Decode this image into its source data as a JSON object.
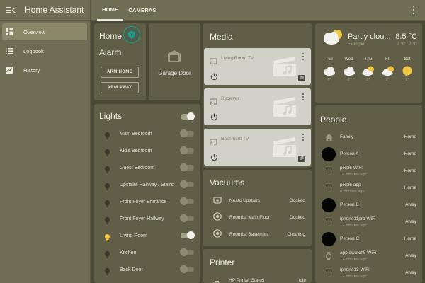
{
  "app": {
    "title": "Home Assistant"
  },
  "sidebar": {
    "items": [
      {
        "label": "Overview",
        "icon": "overview-grid-icon",
        "active": true
      },
      {
        "label": "Logbook",
        "icon": "logbook-list-icon",
        "active": false
      },
      {
        "label": "History",
        "icon": "history-chart-icon",
        "active": false
      }
    ]
  },
  "topbar": {
    "tabs": [
      {
        "label": "HOME",
        "active": true
      },
      {
        "label": "CAMERAS",
        "active": false
      }
    ]
  },
  "alarm": {
    "title_line1": "Home",
    "title_line2": "Alarm",
    "arm_home_label": "ARM HOME",
    "arm_away_label": "ARM AWAY",
    "badge_color": "#1e9e8a"
  },
  "garage": {
    "label": "Garage Door"
  },
  "lights": {
    "title": "Lights",
    "master_on": true,
    "items": [
      {
        "name": "Main Bedroom",
        "on": false
      },
      {
        "name": "Kid's Bedroom",
        "on": false
      },
      {
        "name": "Guest Bedroom",
        "on": false
      },
      {
        "name": "Upstairs Hallway / Stairs",
        "on": false
      },
      {
        "name": "Front Foyer Entrance",
        "on": false
      },
      {
        "name": "Front Foyer Hallway",
        "on": false
      },
      {
        "name": "Living Room",
        "on": true
      },
      {
        "name": "Kitchen",
        "on": false
      },
      {
        "name": "Back Door",
        "on": false
      }
    ]
  },
  "media": {
    "title": "Media",
    "players": [
      {
        "name": "Living Room TV"
      },
      {
        "name": "Receiver"
      },
      {
        "name": "Basement TV"
      }
    ]
  },
  "vacuums": {
    "title": "Vacuums",
    "items": [
      {
        "name": "Neato Upstairs",
        "state": "Docked"
      },
      {
        "name": "Roomba Main Floor",
        "state": "Docked"
      },
      {
        "name": "Roomba Basement",
        "state": "Cleaning"
      }
    ]
  },
  "printer": {
    "title": "Printer",
    "items": [
      {
        "name": "HP Printer Status",
        "state": "idle"
      }
    ]
  },
  "weather": {
    "condition": "Partly clou...",
    "location": "Example",
    "temp": "8.5 °C",
    "range": "7 °C / 7 °C",
    "forecast": [
      {
        "day": "Tue",
        "icon": "cloudy",
        "hi": "7°",
        "lo": "6°"
      },
      {
        "day": "Wed",
        "icon": "cloudy",
        "hi": "8°",
        "lo": "-2°"
      },
      {
        "day": "Thu",
        "icon": "partly-cloudy",
        "hi": "5°",
        "lo": "0°"
      },
      {
        "day": "Fri",
        "icon": "partly-cloudy",
        "hi": "7°",
        "lo": "2°"
      },
      {
        "day": "Sat",
        "icon": "sunny",
        "hi": "9°",
        "lo": "2°"
      }
    ]
  },
  "people": {
    "title": "People",
    "items": [
      {
        "name": "Family",
        "sub": "",
        "state": "Home",
        "icon": "home-icon"
      },
      {
        "name": "Person A",
        "sub": "",
        "state": "Home",
        "icon": "avatar"
      },
      {
        "name": "pixel6 WiFi",
        "sub": "12 minutes ago",
        "state": "Home",
        "icon": "phone-icon"
      },
      {
        "name": "pixel6 app",
        "sub": "6 minutes ago",
        "state": "Home",
        "icon": "phone-icon"
      },
      {
        "name": "Person B",
        "sub": "",
        "state": "Away",
        "icon": "avatar"
      },
      {
        "name": "iphone11pro WiFi",
        "sub": "12 minutes ago",
        "state": "Away",
        "icon": "phone-icon"
      },
      {
        "name": "Person C",
        "sub": "",
        "state": "Home",
        "icon": "avatar"
      },
      {
        "name": "applewatch5 WiFi",
        "sub": "12 minutes ago",
        "state": "Away",
        "icon": "watch-icon"
      },
      {
        "name": "iphone13 WiFi",
        "sub": "12 minutes ago",
        "state": "Away",
        "icon": "phone-icon"
      }
    ]
  }
}
